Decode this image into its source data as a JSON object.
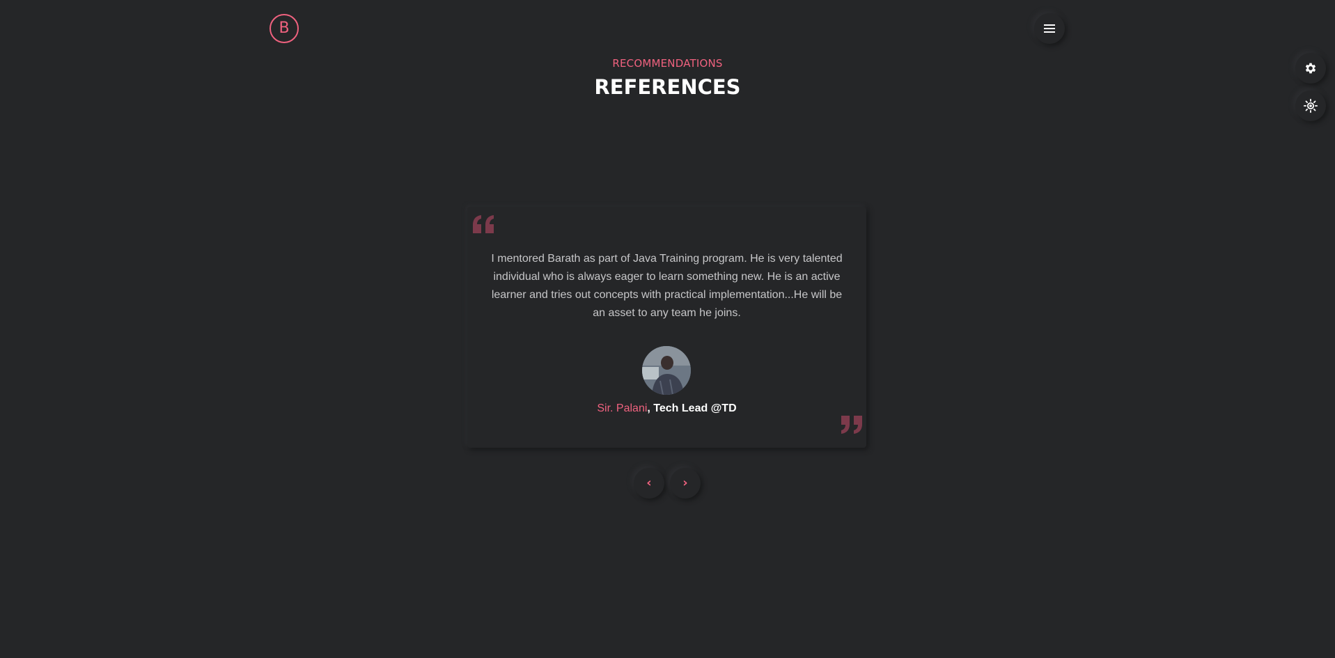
{
  "header": {
    "logo_letter": "B"
  },
  "section": {
    "subtitle": "RECOMMENDATIONS",
    "title": "REFERENCES"
  },
  "testimonial": {
    "text": "I mentored Barath as part of Java Training program. He is very talented individual who is always eager to learn something new. He is an active learner and tries out concepts with practical implementation...He will be an asset to any team he joins.",
    "author_name": "Sir. Palani",
    "author_role": ", Tech Lead @TD"
  },
  "nav": {
    "prev_glyph": "‹",
    "next_glyph": "›"
  },
  "icons": {
    "menu": "hamburger-icon",
    "settings": "gear-icon",
    "theme": "sun-icon",
    "quote_open": "quote-open-icon",
    "quote_close": "quote-close-icon"
  },
  "colors": {
    "accent": "#f0627f",
    "background": "#252628",
    "quote_icon": "#7c3a4b",
    "body_text": "#c7c7c9"
  }
}
